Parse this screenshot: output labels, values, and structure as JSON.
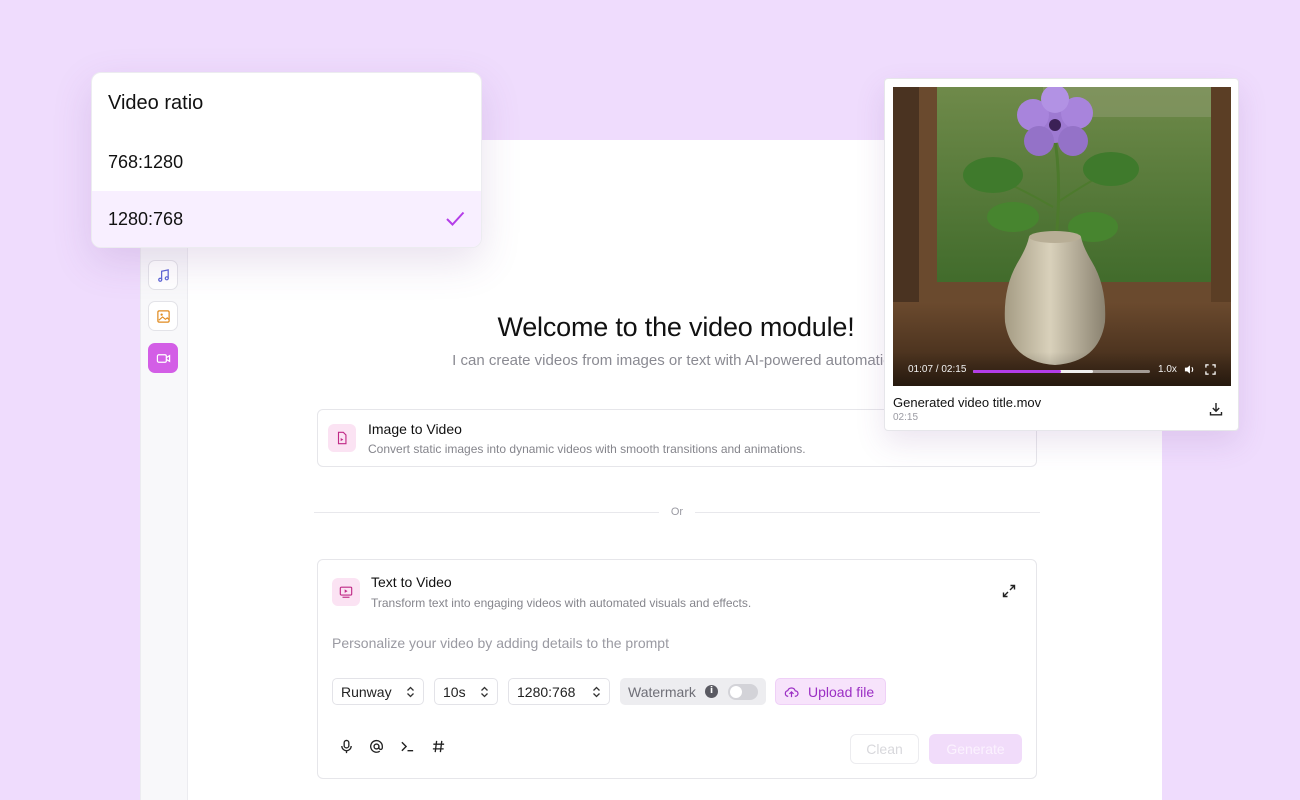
{
  "app": {
    "welcome_title": "Welcome to the video module!",
    "welcome_subtitle": "I can create videos from images or text with AI-powered automation",
    "rail": {
      "items": [
        {
          "name": "music",
          "icon": "music-icon"
        },
        {
          "name": "image",
          "icon": "image-icon"
        },
        {
          "name": "video",
          "icon": "video-icon",
          "active": true
        }
      ]
    },
    "image_to_video": {
      "title": "Image to Video",
      "description": "Convert static images into dynamic videos with smooth transitions and animations."
    },
    "divider_text": "Or",
    "text_to_video": {
      "title": "Text to Video",
      "description": "Transform text into engaging videos with automated visuals and effects.",
      "prompt_placeholder": "Personalize your video by adding details to the prompt",
      "model": "Runway",
      "duration": "10s",
      "ratio": "1280:768",
      "watermark_label": "Watermark",
      "watermark_enabled": false,
      "upload_label": "Upload file",
      "clean_label": "Clean",
      "generate_label": "Generate",
      "tools": [
        "mic-icon",
        "at-icon",
        "terminal-icon",
        "hash-icon"
      ]
    }
  },
  "ratio_dropdown": {
    "title": "Video ratio",
    "options": [
      {
        "label": "768:1280",
        "selected": false
      },
      {
        "label": "1280:768",
        "selected": true
      }
    ]
  },
  "video_card": {
    "time": "01:07 / 02:15",
    "progress": 0.496,
    "buffered": 0.68,
    "speed": "1.0x",
    "title": "Generated video title.mov",
    "duration": "02:15"
  },
  "colors": {
    "background": "#efdcfd",
    "accent": "#b43de8",
    "active_rail": "#d35ee6",
    "upload_text": "#9b2fc4"
  }
}
